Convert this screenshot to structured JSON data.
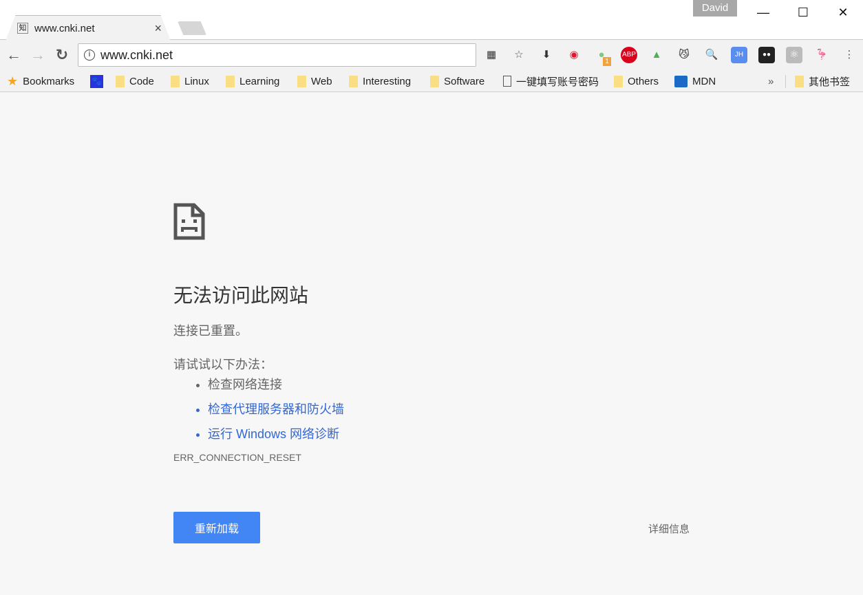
{
  "window": {
    "user": "David",
    "minimize": "—",
    "maximize": "☐",
    "close": "✕"
  },
  "tab": {
    "title": "www.cnki.net",
    "close": "×"
  },
  "omnibox": {
    "url": "www.cnki.net"
  },
  "nav": {
    "back": "←",
    "forward": "→",
    "reload": "↻"
  },
  "extensions": [
    {
      "name": "qr-code-icon",
      "glyph": "▦",
      "color": "#333"
    },
    {
      "name": "bookmark-star-icon",
      "glyph": "☆",
      "color": "#555"
    },
    {
      "name": "download-icon",
      "glyph": "⬇",
      "color": "#333"
    },
    {
      "name": "weibo-icon",
      "glyph": "◉",
      "color": "#e6162d"
    },
    {
      "name": "extension-badge-icon",
      "glyph": "●",
      "color": "#7fc97f",
      "badge": "1"
    },
    {
      "name": "adblock-plus-icon",
      "glyph": "ABP",
      "color": "#fff",
      "bg": "#d9001b"
    },
    {
      "name": "rainbow-icon",
      "glyph": "▲",
      "color": "#4caf50"
    },
    {
      "name": "cat-icon",
      "glyph": "😼",
      "color": "#333"
    },
    {
      "name": "search-tool-icon",
      "glyph": "🔍",
      "color": "#3367d6"
    },
    {
      "name": "jh-icon",
      "glyph": "JH",
      "color": "#fff",
      "bg": "#5b8def"
    },
    {
      "name": "tampermonkey-icon",
      "glyph": "●●",
      "color": "#fff",
      "bg": "#222"
    },
    {
      "name": "react-icon",
      "glyph": "⚛",
      "color": "#fff",
      "bg": "#bbb"
    },
    {
      "name": "flamingo-icon",
      "glyph": "🦩",
      "color": "#e25a7a"
    },
    {
      "name": "menu-icon",
      "glyph": "⋮",
      "color": "#555"
    }
  ],
  "bookmarks": {
    "items": [
      "Bookmarks",
      "",
      "Code",
      "Linux",
      "Learning",
      "Web",
      "Interesting",
      "Software",
      "一键填写账号密码",
      "Others",
      "MDN"
    ],
    "overflow": "»",
    "other": "其他书签"
  },
  "error": {
    "title": "无法访问此网站",
    "message": "连接已重置。",
    "suggest_label": "请试试以下办法：",
    "suggestions": [
      {
        "text": "检查网络连接",
        "link": false
      },
      {
        "text": "检查代理服务器和防火墙",
        "link": true
      },
      {
        "text": "运行 Windows 网络诊断",
        "link": true
      }
    ],
    "code": "ERR_CONNECTION_RESET",
    "reload_button": "重新加载",
    "details_button": "详细信息"
  },
  "colors": {
    "accent": "#4285f4",
    "link": "#3367d6",
    "text": "#646464"
  }
}
